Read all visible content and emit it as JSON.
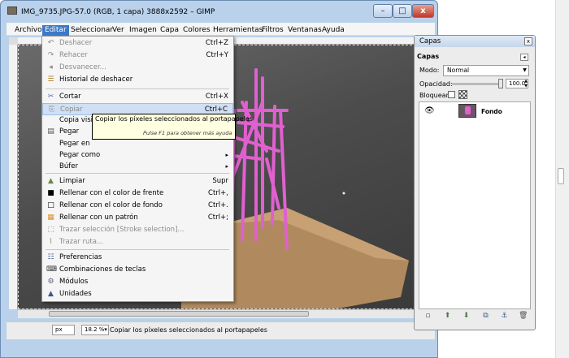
{
  "window": {
    "title": "IMG_9735.JPG-57.0 (RGB, 1 capa) 3888x2592 – GIMP",
    "min_label": "–",
    "max_label": "□",
    "close_label": "x"
  },
  "menubar": [
    {
      "label": "Archivo"
    },
    {
      "label": "Editar"
    },
    {
      "label": "Seleccionar"
    },
    {
      "label": "Ver"
    },
    {
      "label": "Imagen"
    },
    {
      "label": "Capa"
    },
    {
      "label": "Colores"
    },
    {
      "label": "Herramientas"
    },
    {
      "label": "Filtros"
    },
    {
      "label": "Ventanas"
    },
    {
      "label": "Ayuda"
    }
  ],
  "edit_menu": {
    "items": [
      {
        "label": "Deshacer",
        "shortcut": "Ctrl+Z",
        "icon": "undo-icon",
        "glyph": "↶"
      },
      {
        "label": "Rehacer",
        "shortcut": "Ctrl+Y",
        "icon": "redo-icon",
        "glyph": "↷"
      },
      {
        "label": "Desvanecer...",
        "shortcut": "",
        "icon": "fade-icon",
        "glyph": "◂"
      },
      {
        "label": "Historial de deshacer",
        "shortcut": "",
        "icon": "undo-history-icon",
        "glyph": "☰"
      },
      {
        "label": "Cortar",
        "shortcut": "Ctrl+X",
        "icon": "cut-icon",
        "glyph": "✂"
      },
      {
        "label": "Copiar",
        "shortcut": "Ctrl+C",
        "icon": "copy-icon",
        "glyph": "⎘"
      },
      {
        "label": "Copia visible",
        "shortcut": "",
        "icon": "",
        "glyph": ""
      },
      {
        "label": "Pegar",
        "shortcut": "",
        "icon": "paste-icon",
        "glyph": "▤"
      },
      {
        "label": "Pegar en",
        "shortcut": "",
        "icon": "",
        "glyph": ""
      },
      {
        "label": "Pegar como",
        "shortcut": "",
        "icon": "submenu-arrow-icon",
        "glyph": "▸"
      },
      {
        "label": "Búfer",
        "shortcut": "",
        "icon": "submenu-arrow-icon",
        "glyph": "▸"
      },
      {
        "label": "Limpiar",
        "shortcut": "Supr",
        "icon": "clear-icon",
        "glyph": "▲"
      },
      {
        "label": "Rellenar con el color de frente",
        "shortcut": "Ctrl+,",
        "icon": "fill-fg-icon",
        "glyph": "■"
      },
      {
        "label": "Rellenar con el color de fondo",
        "shortcut": "Ctrl+.",
        "icon": "fill-bg-icon",
        "glyph": "□"
      },
      {
        "label": "Rellenar con un patrón",
        "shortcut": "Ctrl+;",
        "icon": "fill-pattern-icon",
        "glyph": "▦"
      },
      {
        "label": "Trazar selección [Stroke selection]...",
        "shortcut": "",
        "icon": "stroke-selection-icon",
        "glyph": "⬚"
      },
      {
        "label": "Trazar ruta...",
        "shortcut": "",
        "icon": "stroke-path-icon",
        "glyph": "⌇"
      },
      {
        "label": "Preferencias",
        "shortcut": "",
        "icon": "preferences-icon",
        "glyph": "☷"
      },
      {
        "label": "Combinaciones de teclas",
        "shortcut": "",
        "icon": "keyboard-icon",
        "glyph": "⌨"
      },
      {
        "label": "Módulos",
        "shortcut": "",
        "icon": "modules-icon",
        "glyph": "⚙"
      },
      {
        "label": "Unidades",
        "shortcut": "",
        "icon": "units-icon",
        "glyph": "▲"
      }
    ]
  },
  "tooltip": {
    "text": "Copiar los píxeles seleccionados al portapapeles",
    "help": "Pulse F1 para obtener más ayuda"
  },
  "statusbar": {
    "unit": "px",
    "zoom": "18.2 %",
    "message": "Copiar los píxeles seleccionados al portapapeles"
  },
  "layers_dock": {
    "title": "Capas",
    "close_label": "x",
    "tab_label": "Capas",
    "mode_label": "Modo:",
    "mode_value": "Normal",
    "opacity_label": "Opacidad:",
    "opacity_value": "100.0",
    "lock_label": "Bloquear:",
    "layer_name": "Fondo"
  },
  "colors": {
    "menu_highlight": "#3d78c7",
    "item_highlight": "#cfdff4",
    "strut_pink": "#e060d0",
    "tooltip_bg": "#ffffe1"
  }
}
